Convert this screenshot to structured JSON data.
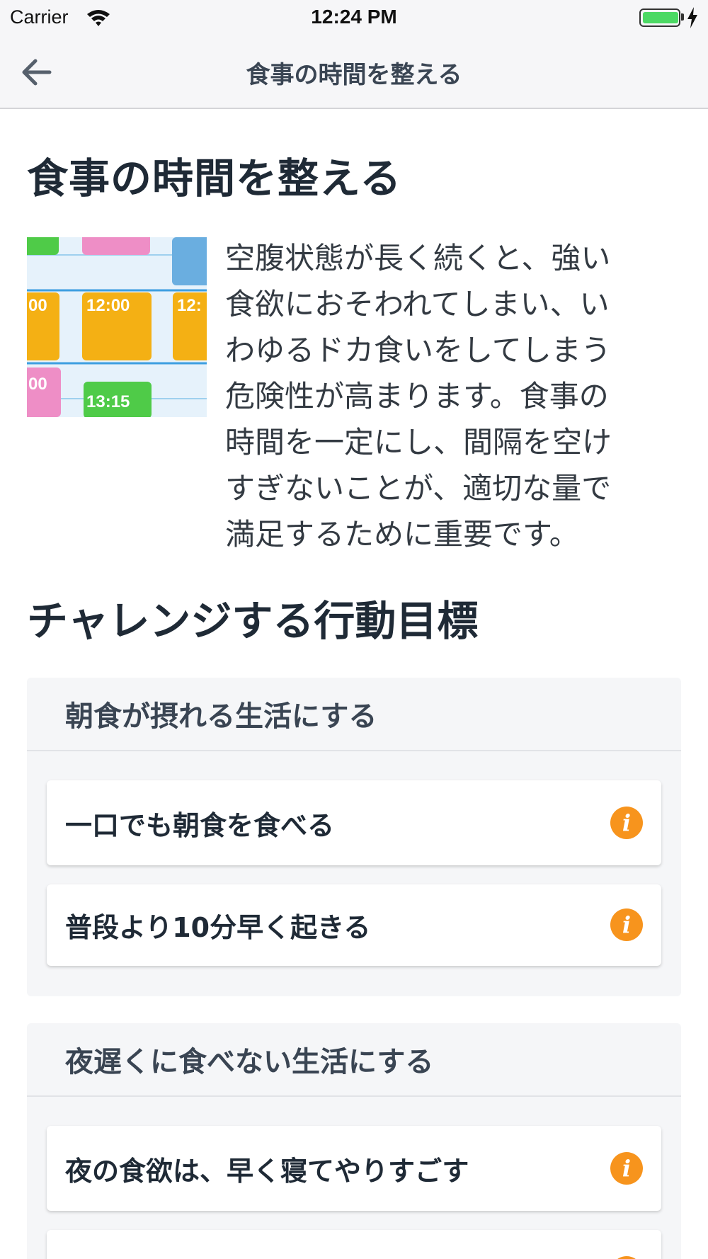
{
  "status_bar": {
    "carrier": "Carrier",
    "time": "12:24 PM",
    "battery_level": 1.0
  },
  "nav": {
    "back_icon": "back-arrow-icon",
    "title": "食事の時間を整える"
  },
  "page": {
    "title": "食事の時間を整える",
    "intro_lines": [
      "空腹状態が長く続くと、強い",
      "食欲におそわれてしまい、い",
      "わゆるドカ食いをしてしまう",
      "危険性が高まります。食事の",
      "時間を一定にし、間隔を空け",
      "すぎないことが、適切な量で",
      "満足するために重要です。"
    ],
    "image": {
      "labels": [
        "00",
        "12:00",
        "12:",
        "00",
        "13:15"
      ]
    },
    "section_title": "チャレンジする行動目標"
  },
  "groups": [
    {
      "title": "朝食が摂れる生活にする",
      "goals": [
        {
          "label": "一口でも朝食を食べる",
          "icon": "info-icon"
        },
        {
          "label": "普段より10分早く起きる",
          "icon": "info-icon"
        }
      ]
    },
    {
      "title": "夜遅くに食べない生活にする",
      "goals": [
        {
          "label": "夜の食欲は、早く寝てやりすごす",
          "icon": "info-icon"
        }
      ]
    }
  ],
  "colors": {
    "accent_info": "#f7941d",
    "text_dark": "#1f2a36",
    "group_bg": "#f5f6f8",
    "block_orange": "#f4b014",
    "block_pink": "#ee8ec6",
    "block_green": "#4fcb48",
    "block_blue": "#6aaee0"
  }
}
